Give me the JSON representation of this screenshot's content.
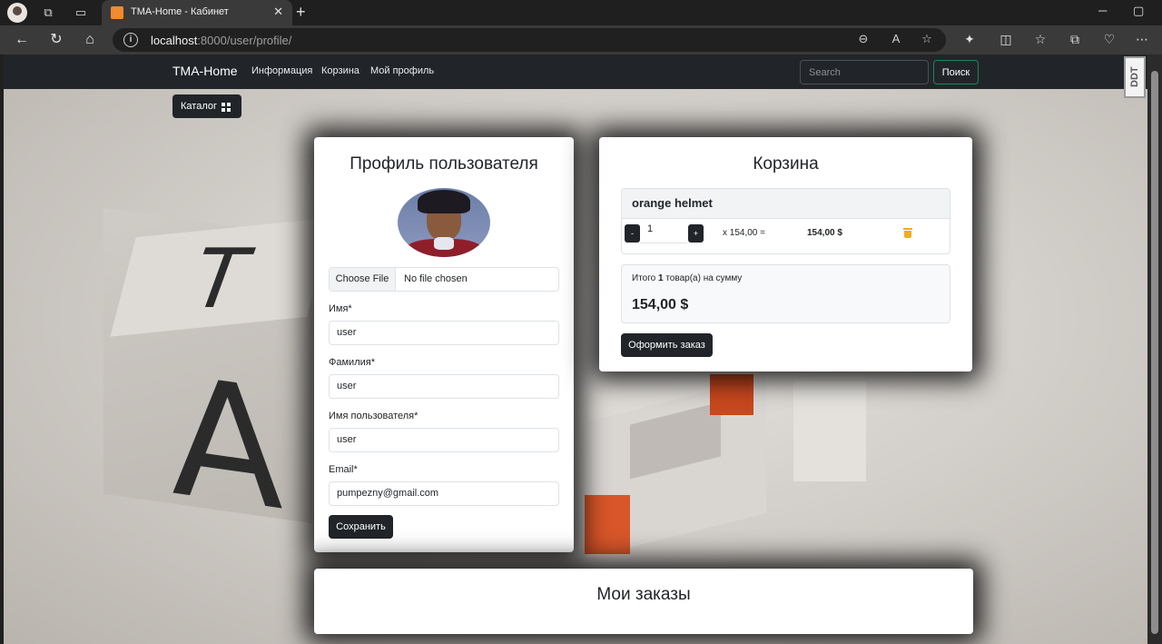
{
  "browser": {
    "tab_title": "TMA-Home - Кабинет",
    "url_host": "localhost",
    "url_path": ":8000/user/profile/"
  },
  "navbar": {
    "brand": "TMA-Home",
    "links": [
      "Информация",
      "Корзина",
      "Мой профиль"
    ],
    "search_placeholder": "Search",
    "search_button": "Поиск",
    "extension_badge": "DDT"
  },
  "catalog_button": "Каталог",
  "profile": {
    "title": "Профиль пользователя",
    "file_choose": "Choose File",
    "file_status": "No file chosen",
    "fields": [
      {
        "label": "Имя*",
        "value": "user"
      },
      {
        "label": "Фамилия*",
        "value": "user"
      },
      {
        "label": "Имя пользователя*",
        "value": "user"
      },
      {
        "label": "Email*",
        "value": "pumpezny@gmail.com"
      }
    ],
    "save_button": "Сохранить"
  },
  "cart": {
    "title": "Корзина",
    "items": [
      {
        "name": "orange helmet",
        "quantity": "1",
        "unit_price": "x 154,00 =",
        "total": "154,00 $",
        "minus": "-",
        "plus": "+"
      }
    ],
    "summary_prefix": "Итого",
    "summary_count": "1",
    "summary_suffix": "товар(а) на сумму",
    "summary_total": "154,00 $",
    "checkout_button": "Оформить заказ"
  },
  "orders": {
    "title": "Мои заказы"
  },
  "colors": {
    "navbar_bg": "#212529",
    "search_border": "#198754",
    "trash": "#f0ad1c"
  }
}
